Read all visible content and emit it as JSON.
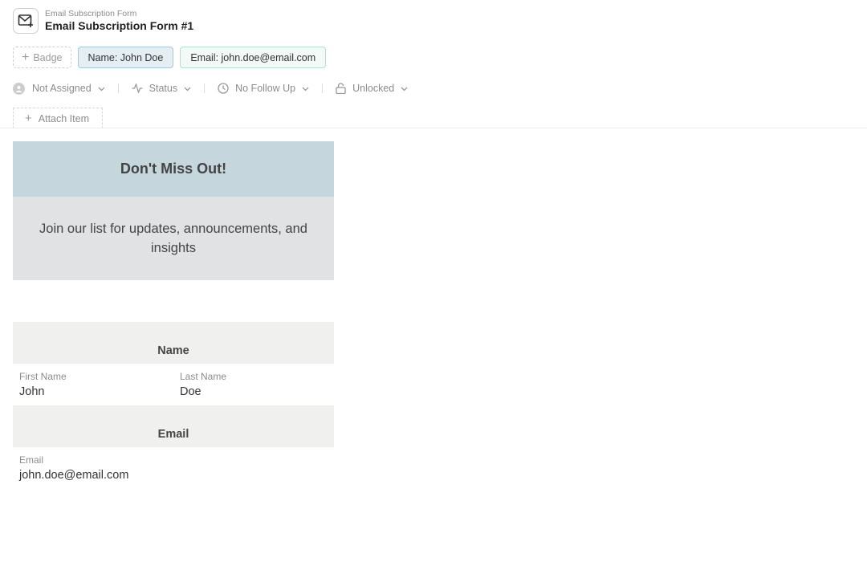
{
  "header": {
    "breadcrumb": "Email Subscription Form",
    "title": "Email Subscription Form #1",
    "icon": "mail-plus-icon"
  },
  "badges": {
    "add_label": "Badge",
    "name": "Name: John Doe",
    "email": "Email: john.doe@email.com"
  },
  "properties": {
    "assignee": "Not Assigned",
    "status": "Status",
    "follow_up": "No Follow Up",
    "lock": "Unlocked"
  },
  "attach": {
    "label": "Attach Item"
  },
  "hero": {
    "heading": "Don't Miss Out!",
    "body": "Join our list for updates, announcements, and insights"
  },
  "sections": {
    "name": {
      "heading": "Name",
      "first_name_label": "First Name",
      "first_name_value": "John",
      "last_name_label": "Last Name",
      "last_name_value": "Doe"
    },
    "email": {
      "heading": "Email",
      "email_label": "Email",
      "email_value": "john.doe@email.com"
    }
  },
  "colors": {
    "hero_header": "#c5d6dd",
    "hero_body": "#e0e2e3",
    "section_header": "#f0f0ee",
    "badge_name_bg": "#e4eef3",
    "badge_email_bg": "#f2f9f6"
  }
}
